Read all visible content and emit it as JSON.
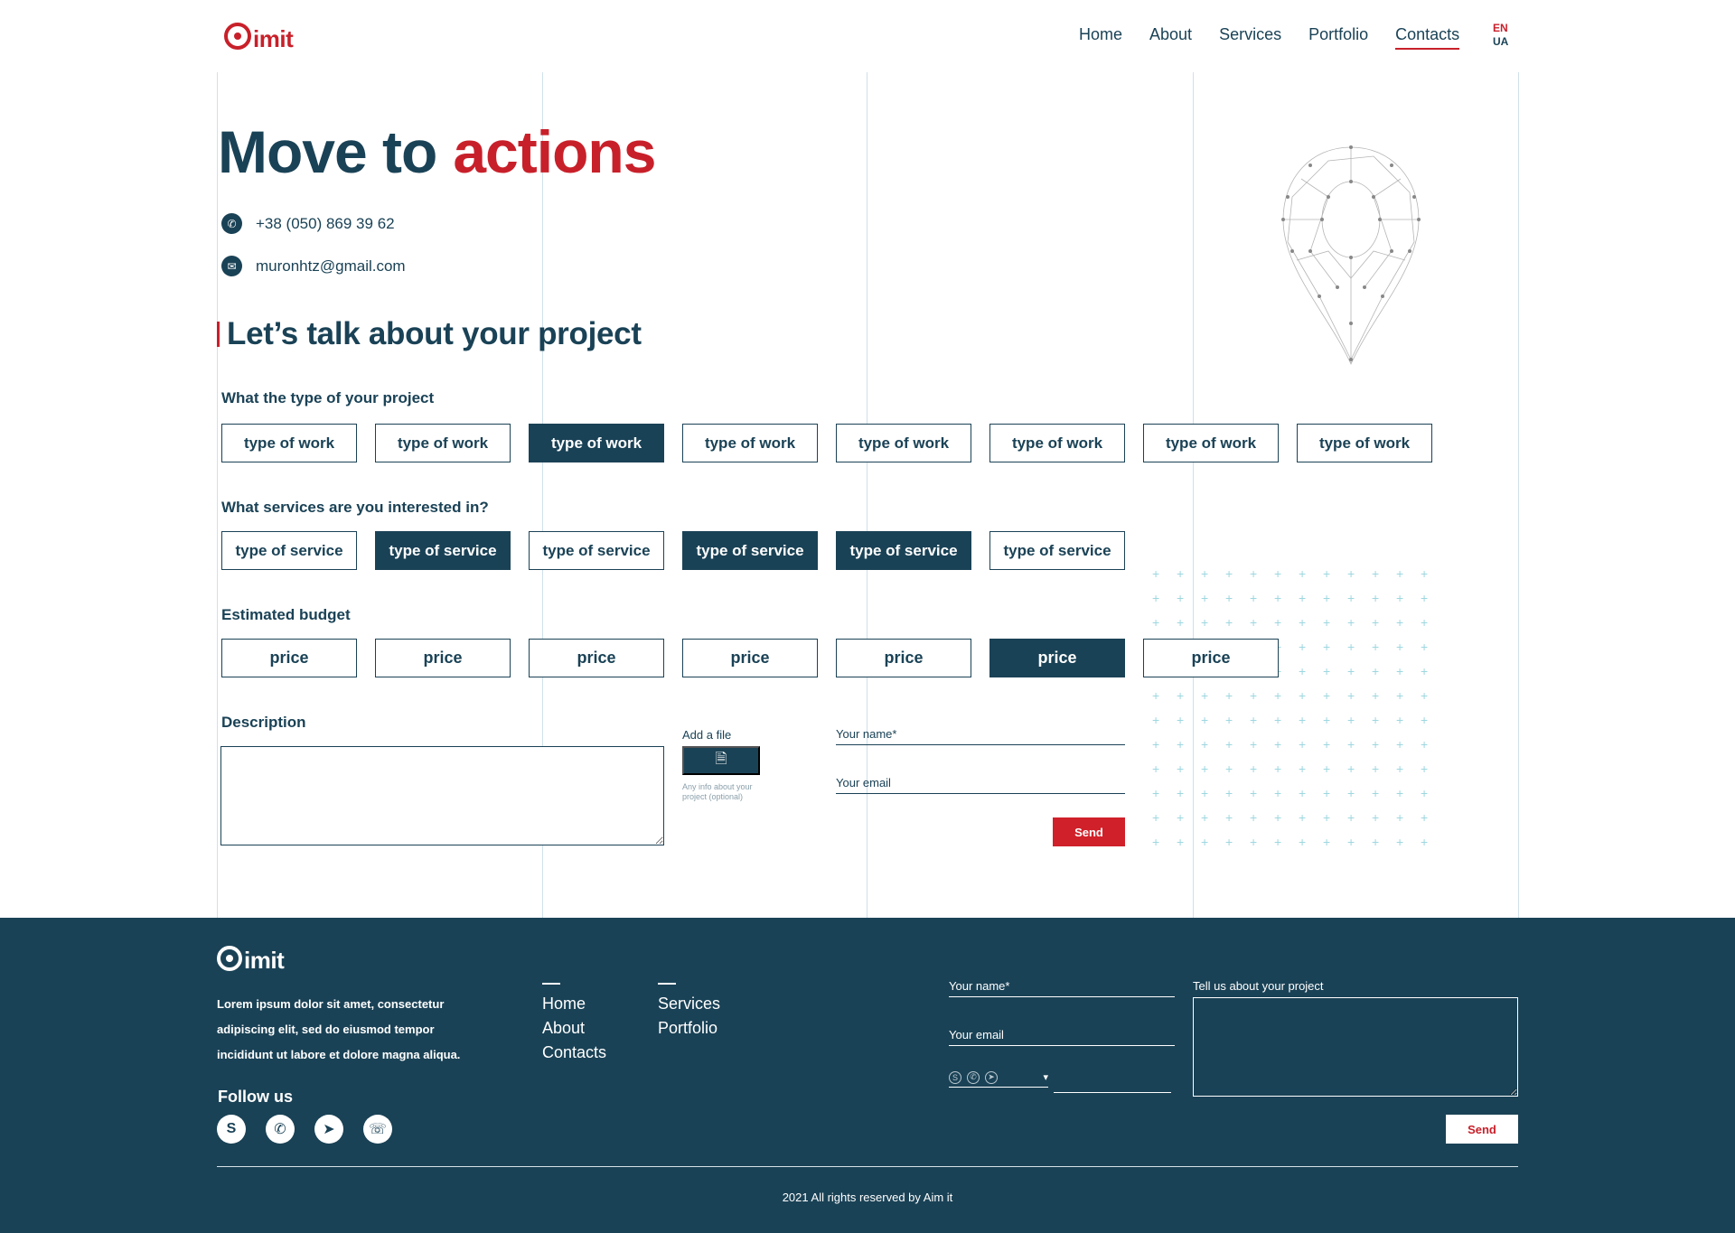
{
  "header": {
    "logo_text": "imit",
    "nav": [
      {
        "label": "Home",
        "active": false
      },
      {
        "label": "About",
        "active": false
      },
      {
        "label": "Services",
        "active": false
      },
      {
        "label": "Portfolio",
        "active": false
      },
      {
        "label": "Contacts",
        "active": true
      }
    ],
    "lang_en": "EN",
    "lang_ua": "UA"
  },
  "hero": {
    "title_main": "Move to",
    "title_accent": "actions",
    "phone": "+38 (050) 869 39 62",
    "email": "muronhtz@gmail.com"
  },
  "form": {
    "heading": "Let’s talk about your project",
    "type_label": "What the type of your project",
    "type_options": [
      "type of work",
      "type of work",
      "type of work",
      "type of work",
      "type of work",
      "type of work",
      "type of work",
      "type of work"
    ],
    "type_selected": [
      2
    ],
    "service_label": "What services are you interested in?",
    "service_options": [
      "type of service",
      "type of service",
      "type of service",
      "type of service",
      "type of service",
      "type of service"
    ],
    "service_selected": [
      1,
      3,
      4
    ],
    "budget_label": "Estimated budget",
    "budget_options": [
      "price",
      "price",
      "price",
      "price",
      "price",
      "price",
      "price"
    ],
    "budget_selected": [
      5
    ],
    "description_label": "Description",
    "file_label": "Add a file",
    "file_hint": "Any info about your project (optional)",
    "name_placeholder": "Your name*",
    "email_placeholder": "Your email",
    "send_label": "Send"
  },
  "footer": {
    "logo_text": "imit",
    "description": "Lorem ipsum dolor sit amet, consectetur adipiscing elit, sed do eiusmod tempor incididunt ut labore et dolore magna aliqua.",
    "follow_label": "Follow us",
    "col1": [
      "Home",
      "About",
      "Contacts"
    ],
    "col2": [
      "Services",
      "Portfolio"
    ],
    "name_placeholder": "Your name*",
    "email_placeholder": "Your email",
    "project_label": "Tell us about your project",
    "send_label": "Send",
    "copyright": "2021 All rights reserved by Aim it"
  },
  "colors": {
    "brand_red": "#c8202a",
    "navy": "#1a4256"
  }
}
